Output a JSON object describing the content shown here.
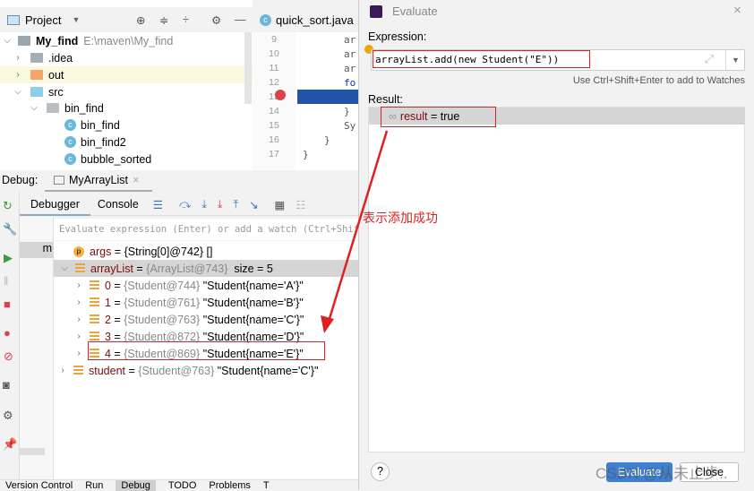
{
  "project": {
    "title": "Project",
    "root": {
      "name": "My_find",
      "path": "E:\\maven\\My_find"
    },
    "items": [
      {
        "name": ".idea",
        "type": "folder"
      },
      {
        "name": "out",
        "type": "folder-orange"
      },
      {
        "name": "src",
        "type": "folder-blue"
      },
      {
        "name": "bin_find",
        "type": "package"
      },
      {
        "name": "bin_find",
        "type": "class"
      },
      {
        "name": "bin_find2",
        "type": "class"
      },
      {
        "name": "bubble_sorted",
        "type": "class"
      }
    ]
  },
  "editor": {
    "tab": "quick_sort.java",
    "line_numbers": [
      "9",
      "10",
      "11",
      "12",
      "13",
      "14",
      "15",
      "16",
      "17"
    ],
    "code": [
      "ar",
      "ar",
      "ar",
      "fo",
      "",
      "}",
      "Sy",
      "}",
      "}"
    ]
  },
  "debug": {
    "label": "Debug:",
    "session_tab": "MyArrayList",
    "tabs": [
      "Debugger",
      "Console"
    ],
    "frame": "m",
    "eval_placeholder": "Evaluate expression (Enter) or add a watch (Ctrl+Shift+Enter)",
    "variables": [
      {
        "name": "args",
        "value": "{String[0]@742} []"
      },
      {
        "name": "arrayList",
        "value": "{ArrayList@743}",
        "extra": "size = 5"
      },
      {
        "name": "0",
        "value": "{Student@744}",
        "str": "\"Student{name='A'}\""
      },
      {
        "name": "1",
        "value": "{Student@761}",
        "str": "\"Student{name='B'}\""
      },
      {
        "name": "2",
        "value": "{Student@763}",
        "str": "\"Student{name='C'}\""
      },
      {
        "name": "3",
        "value": "{Student@872}",
        "str": "\"Student{name='D'}\""
      },
      {
        "name": "4",
        "value": "{Student@869}",
        "str": "\"Student{name='E'}\""
      },
      {
        "name": "student",
        "value": "{Student@763}",
        "str": "\"Student{name='C'}\""
      }
    ]
  },
  "status_bar": [
    "Version Control",
    "Run",
    "Debug",
    "TODO",
    "Problems",
    "T"
  ],
  "dialog": {
    "title": "Evaluate",
    "expression_label": "Expression:",
    "expression": "arrayList.add(new Student(\"E\"))",
    "hint": "Use Ctrl+Shift+Enter to add to Watches",
    "result_label": "Result:",
    "result_name": "result",
    "result_value": "true",
    "help": "?",
    "evaluate_button": "Evaluate",
    "close_button": "Close"
  },
  "annotation": {
    "text": "表示添加成功",
    "color": "#e02020"
  },
  "watermark": "CSDN @从未止步.."
}
